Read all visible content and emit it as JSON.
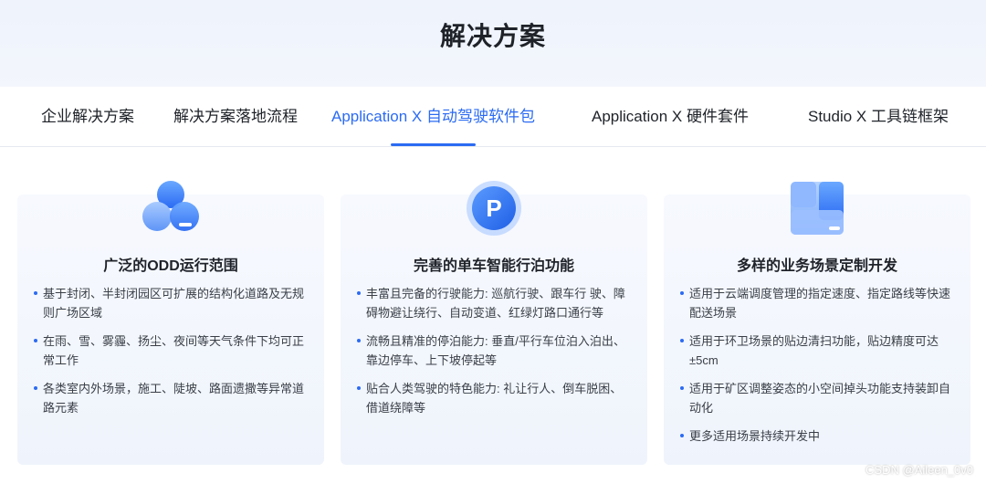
{
  "hero": {
    "title": "解决方案"
  },
  "tabs": [
    {
      "label": "企业解决方案",
      "active": false
    },
    {
      "label": "解决方案落地流程",
      "active": false
    },
    {
      "label": "Application X 自动驾驶软件包",
      "active": true
    },
    {
      "label": "Application X 硬件套件",
      "active": false
    },
    {
      "label": "Studio X 工具链框架",
      "active": false
    }
  ],
  "accent_color": "#2b6bf3",
  "cards": [
    {
      "icon": "hexagon-cluster-icon",
      "title": "广泛的ODD运行范围",
      "items": [
        "基于封闭、半封闭园区可扩展的结构化道路及无规则广场区域",
        "在雨、雪、雾霾、扬尘、夜间等天气条件下均可正常工作",
        "各类室内外场景，施工、陡坡、路面遗撒等异常道路元素"
      ]
    },
    {
      "icon": "parking-p-icon",
      "title": "完善的单车智能行泊功能",
      "items": [
        "丰富且完备的行驶能力: 巡航行驶、跟车行 驶、障碍物避让绕行、自动变道、红绿灯路口通行等",
        "流畅且精准的停泊能力: 垂直/平行车位泊入泊出、靠边停车、上下坡停起等",
        "贴合人类驾驶的特色能力: 礼让行人、倒车脱困、借道绕障等"
      ]
    },
    {
      "icon": "grid-blocks-icon",
      "title": "多样的业务场景定制开发",
      "items": [
        "适用于云端调度管理的指定速度、指定路线等快速配送场景",
        "适用于环卫场景的贴边清扫功能，贴边精度可达±5cm",
        "适用于矿区调整姿态的小空间掉头功能支持装卸自动化",
        "更多适用场景持续开发中"
      ]
    }
  ],
  "watermark": "CSDN @Aileen_0v0"
}
